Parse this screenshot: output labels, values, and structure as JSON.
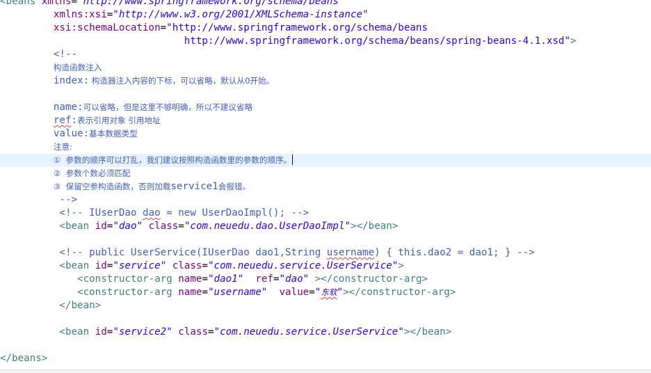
{
  "colors": {
    "tag": "#3f7f7f",
    "attribute": "#7f007f",
    "attribute_value": "#2a00ff",
    "comment": "#3f5fbf",
    "current_line": "#e8f2fe",
    "caret": "#000000",
    "spelling_squiggle": "#d84040"
  },
  "l1": {
    "open": "<beans",
    "attr": "xmlns",
    "eq": "=",
    "val": "\"http://www.springframework.org/schema/beans\""
  },
  "l2": {
    "attr": "xmlns:xsi",
    "eq": "=",
    "val": "\"http://www.w3.org/2001/XMLSchema-instance\""
  },
  "l3": {
    "attr": "xsi:schemaLocation",
    "eq": "=",
    "val": "\"http://www.springframework.org/schema/beans"
  },
  "l4": {
    "val": "http://www.springframework.org/schema/beans/spring-beans-4.1.xsd\"",
    "close": ">"
  },
  "l5": {
    "text": "<!--"
  },
  "l6": {
    "text": "构造函数注入"
  },
  "l7": {
    "key": "index:",
    "text": " 构造器注入内容的下标，可以省略，默认从0开始。"
  },
  "l8": {
    "key": "name:",
    "text": "可以省略，但是这里不够明确，所以不建议省略"
  },
  "l9": {
    "key_a": "ref",
    "key_b": ":",
    "text": "表示引用对象 引用地址"
  },
  "l10": {
    "key": "value:",
    "text": "基本数据类型"
  },
  "l11": {
    "text": "注意:"
  },
  "l12": {
    "text": "①  参数的顺序可以打乱，我们建议按照构造函数里的参数的顺序。"
  },
  "l13": {
    "text": "②  参数个数必须匹配"
  },
  "l14": {
    "text_a": "③  保留空参构造函数，否则加载",
    "code": "service1",
    "text_b": "会报错。"
  },
  "l15": {
    "text": "-->"
  },
  "l16": {
    "a": "<!-- IUserDao ",
    "b": "dao",
    "c": " = new UserDaoImpl(); -->"
  },
  "l17": {
    "open": "<bean",
    "attr1": "id",
    "eq1": "=",
    "val1": "\"dao\"",
    "attr2": "class",
    "eq2": "=",
    "val2": "\"com.neuedu.dao.UserDaoImpl\"",
    "close": "></bean>"
  },
  "l18": {
    "a": "<!-- public UserService(IUserDao dao1,String ",
    "b": "username",
    "c": ") { this.dao2 = dao1; } -->"
  },
  "l19": {
    "open": "<bean",
    "attr1": "id",
    "eq1": "=",
    "val1": "\"service\"",
    "attr2": "class",
    "eq2": "=",
    "val2": "\"com.neuedu.service.UserService\"",
    "close": ">"
  },
  "l20": {
    "open": "<constructor-arg",
    "attr1": "name",
    "eq1": "=",
    "val1": "\"dao1\"",
    "attr2": "ref",
    "eq2": "=",
    "val2": "\"dao\"",
    "close": "></constructor-arg>"
  },
  "l21": {
    "open": "<constructor-arg",
    "attr1": "name",
    "eq1": "=",
    "val1": "\"username\"",
    "attr2": "value",
    "eq2": "=",
    "val2_q1": "\"",
    "val2_text": "东软",
    "val2_q2": "\"",
    "close": "></constructor-arg>"
  },
  "l22": {
    "text": "</bean>"
  },
  "l23": {
    "open": "<bean",
    "attr1": "id",
    "eq1": "=",
    "val1": "\"service2\"",
    "attr2": "class",
    "eq2": "=",
    "val2": "\"com.neuedu.service.UserService\"",
    "close": "></bean>"
  },
  "l24": {
    "text": "</beans>"
  }
}
